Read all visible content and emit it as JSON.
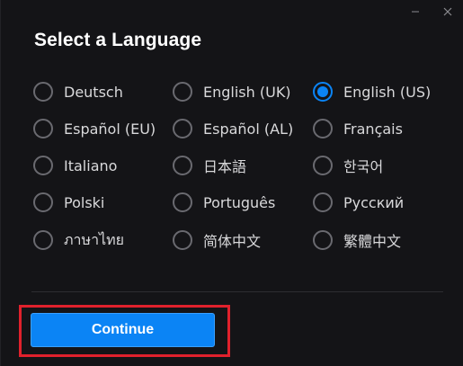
{
  "dialog": {
    "title": "Select a Language",
    "selected": "English (US)",
    "accent_color": "#0b84f5",
    "highlight_color": "#e0212c"
  },
  "window_controls": {
    "minimize_icon": "minimize-icon",
    "close_icon": "close-icon"
  },
  "languages": [
    [
      "Deutsch",
      "English (UK)",
      "English (US)"
    ],
    [
      "Español (EU)",
      "Español (AL)",
      "Français"
    ],
    [
      "Italiano",
      "日本語",
      "한국어"
    ],
    [
      "Polski",
      "Português",
      "Русский"
    ],
    [
      "ภาษาไทย",
      "简体中文",
      "繁體中文"
    ]
  ],
  "footer": {
    "continue_label": "Continue"
  }
}
